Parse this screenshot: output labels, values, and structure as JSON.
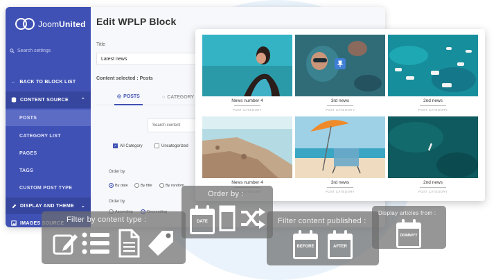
{
  "brand": {
    "name_light": "Joom",
    "name_bold": "United"
  },
  "sidebar": {
    "search_placeholder": "Search settings",
    "back": "BACK TO BLOCK LIST",
    "content_source": "CONTENT SOURCE",
    "items": [
      "POSTS",
      "CATEGORY LIST",
      "PAGES",
      "TAGS",
      "CUSTOM POST TYPE"
    ],
    "display_theme": "DISPLAY AND THEME",
    "images_source": "IMAGES SOURCE"
  },
  "editor": {
    "title": "Edit WPLP Block",
    "title_label": "Title",
    "title_value": "Latest news",
    "content_selected": "Content selected : Posts",
    "tab_posts": "POSTS",
    "tab_category": "CATEGORY",
    "search_content": "Search content",
    "all_category": "All Category",
    "uncategorized": "Uncategorized",
    "order_by_label": "Order by",
    "order_by_options": [
      "By date",
      "By title",
      "By random"
    ],
    "order_label": "Order by",
    "order_options": [
      "Ascending",
      "Descending"
    ]
  },
  "news": [
    {
      "title": "News number 4",
      "meta": "POST CATEGORY"
    },
    {
      "title": "3rd news",
      "meta": "POST CATEGORY"
    },
    {
      "title": "2nd news",
      "meta": "POST CATEGORY"
    },
    {
      "title": "News number 4",
      "meta": "POST CATEGORY"
    },
    {
      "title": "3rd news",
      "meta": "POST CATEGORY"
    },
    {
      "title": "2nd news",
      "meta": "POST CATEGORY"
    }
  ],
  "overlays": {
    "filter_type": "Filter by content type :",
    "order_by": "Order by :",
    "filter_published": "Filter content published :",
    "display_from": "Display articles from :",
    "date_label": "DATE",
    "before_label": "BEFORE",
    "after_label": "AFTER",
    "cal_from_label": "DD/MM/YY"
  },
  "colors": {
    "accent": "#3f51b5",
    "overlay": "#6e6e6e"
  }
}
